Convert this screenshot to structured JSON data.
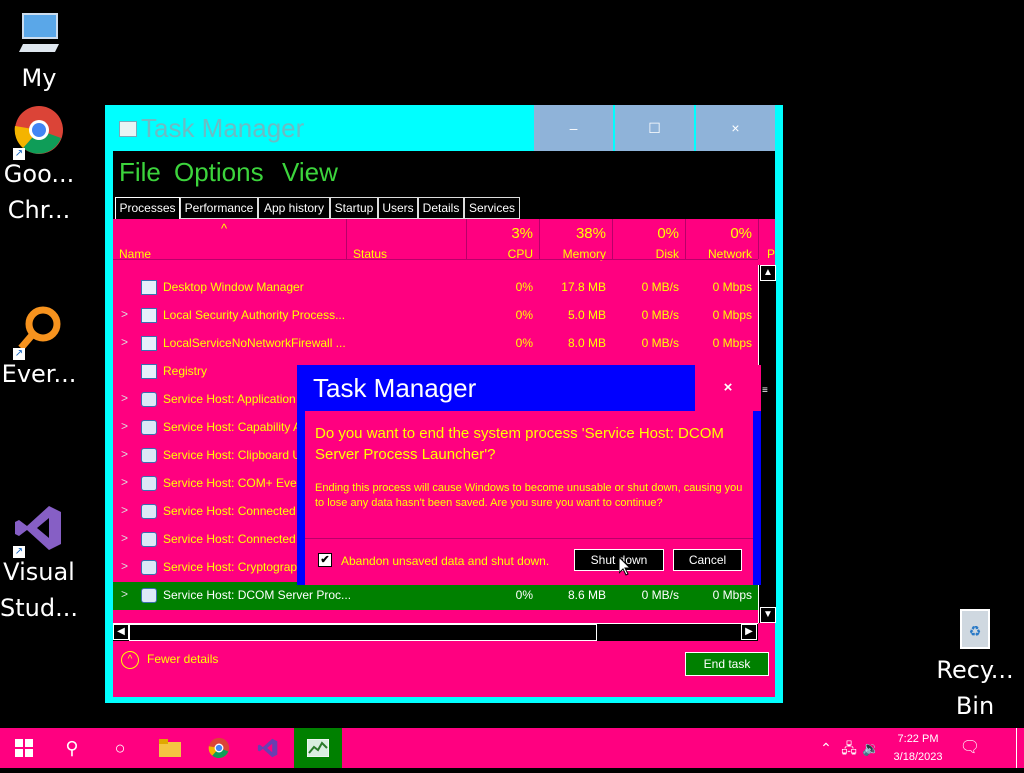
{
  "desktop": {
    "icons": [
      {
        "label": "My",
        "icon": "computer-icon"
      },
      {
        "label": "Goo...\nChr...",
        "icon": "chrome-icon"
      },
      {
        "label": "Ever...",
        "icon": "search-everything-icon"
      },
      {
        "label": "Visual\nStud...",
        "icon": "visual-studio-icon"
      },
      {
        "label": "Recy...\nBin",
        "icon": "recycle-bin-icon"
      }
    ]
  },
  "task_manager": {
    "title": "Task Manager",
    "min": "–",
    "max": "☐",
    "close": "×",
    "menu": [
      "File",
      "Options",
      "View"
    ],
    "tabs": [
      "Processes",
      "Performance",
      "App history",
      "Startup",
      "Users",
      "Details",
      "Services"
    ],
    "sort_arrow": "^",
    "columns": {
      "name": "Name",
      "status": "Status",
      "cpu": {
        "label": "CPU",
        "value": "3%"
      },
      "memory": {
        "label": "Memory",
        "value": "38%"
      },
      "disk": {
        "label": "Disk",
        "value": "0%"
      },
      "network": {
        "label": "Network",
        "value": "0%"
      },
      "power": "P"
    },
    "rows": [
      {
        "name": "Desktop Window Manager",
        "cpu": "0%",
        "memory": "17.8 MB",
        "disk": "0 MB/s",
        "network": "0 Mbps",
        "expand": ""
      },
      {
        "name": "Local Security Authority Process...",
        "cpu": "0%",
        "memory": "5.0 MB",
        "disk": "0 MB/s",
        "network": "0 Mbps",
        "expand": ">"
      },
      {
        "name": "LocalServiceNoNetworkFirewall ...",
        "cpu": "0%",
        "memory": "8.0 MB",
        "disk": "0 MB/s",
        "network": "0 Mbps",
        "expand": ">"
      },
      {
        "name": "Registry",
        "cpu": "",
        "memory": "",
        "disk": "",
        "network": "",
        "expand": ""
      },
      {
        "name": "Service Host: Application",
        "cpu": "",
        "memory": "",
        "disk": "",
        "network": "",
        "expand": ">"
      },
      {
        "name": "Service Host: Capability A",
        "cpu": "",
        "memory": "",
        "disk": "",
        "network": "",
        "expand": ">"
      },
      {
        "name": "Service Host: Clipboard U",
        "cpu": "",
        "memory": "",
        "disk": "",
        "network": "",
        "expand": ">"
      },
      {
        "name": "Service Host: COM+ Even",
        "cpu": "",
        "memory": "",
        "disk": "",
        "network": "",
        "expand": ">"
      },
      {
        "name": "Service Host: Connected",
        "cpu": "",
        "memory": "",
        "disk": "",
        "network": "",
        "expand": ">"
      },
      {
        "name": "Service Host: Connected",
        "cpu": "",
        "memory": "",
        "disk": "",
        "network": "",
        "expand": ">"
      },
      {
        "name": "Service Host: Cryptograpl",
        "cpu": "",
        "memory": "",
        "disk": "",
        "network": "",
        "expand": ">"
      },
      {
        "name": "Service Host: DCOM Server Proc...",
        "cpu": "0%",
        "memory": "8.6 MB",
        "disk": "0 MB/s",
        "network": "0 Mbps",
        "expand": ">",
        "selected": true
      }
    ],
    "fewer_details": "Fewer details",
    "end_task": "End task"
  },
  "dialog": {
    "title": "Task Manager",
    "close": "×",
    "question": "Do you want to end the system process 'Service Host: DCOM Server Process Launcher'?",
    "description": "Ending this process will cause Windows to become unusable or shut down, causing you to lose any data hasn't been saved. Are you sure you want to continue?",
    "checkbox_label": "Abandon unsaved data and shut down.",
    "checkbox_checked": true,
    "shutdown_label": "Shut down",
    "cancel_label": "Cancel"
  },
  "taskbar": {
    "time": "7:22 PM",
    "date": "3/18/2023"
  },
  "colors": {
    "accent": "#ff0080",
    "text": "#ffff00",
    "selected": "#008000",
    "dialog_title_bar": "#0000ff",
    "window_frame": "#00ffff"
  }
}
